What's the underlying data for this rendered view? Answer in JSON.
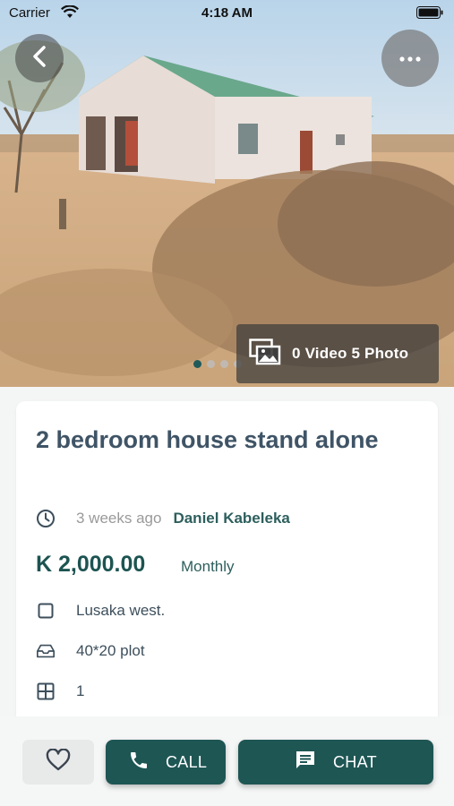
{
  "status_bar": {
    "carrier": "Carrier",
    "time": "4:18 AM"
  },
  "gallery": {
    "media_count": "0 Video 5 Photo",
    "dots_total": 4,
    "active_dot": 1
  },
  "listing": {
    "title": "2 bedroom house stand alone",
    "posted": "3 weeks ago",
    "author": "Daniel Kabeleka",
    "price": "K 2,000.00",
    "period": "Monthly",
    "location": "Lusaka west.",
    "plot_size": "40*20 plot",
    "rooms": "1"
  },
  "actions": {
    "call_label": "CALL",
    "chat_label": "CHAT"
  },
  "colors": {
    "primary": "#1e5654",
    "title": "#3f5466"
  },
  "icons": {
    "back": "chevron-left-icon",
    "more": "ellipsis-icon",
    "media": "photo-gallery-icon",
    "posted": "clock-icon",
    "location": "square-outline-icon",
    "plot": "tray-icon",
    "rooms": "grid-icon",
    "favorite": "heart-icon",
    "call": "phone-icon",
    "chat": "chat-bubble-icon"
  }
}
